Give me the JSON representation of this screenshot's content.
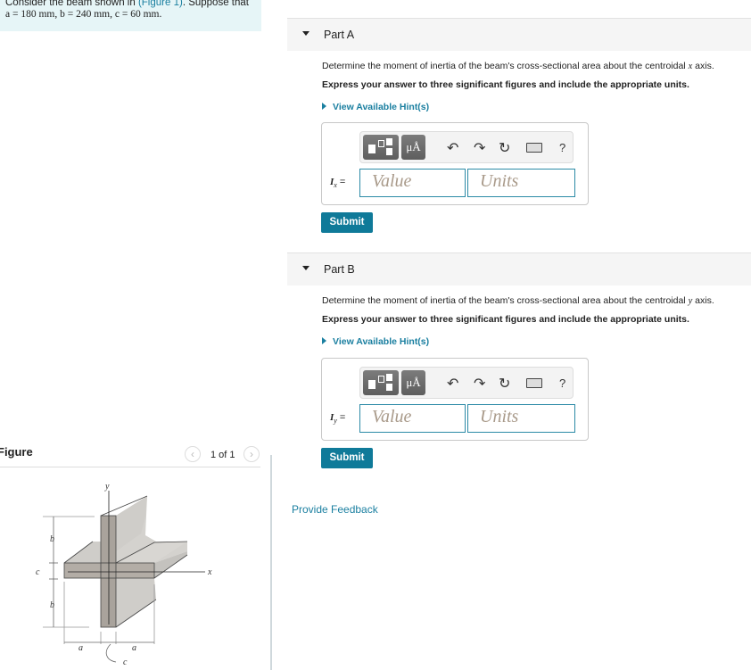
{
  "problem": {
    "line1_prefix": "Consider the beam shown in ",
    "figure_link": "(Figure 1)",
    "line1_suffix": ". Suppose that",
    "line2": "a = 180 mm, b = 240 mm, c = 60 mm."
  },
  "figure": {
    "title": "Figure",
    "pager": "1 of 1",
    "prev_icon": "chevron-left",
    "next_icon": "chevron-right",
    "labels": {
      "y": "y",
      "x": "x",
      "a": "a",
      "b": "b",
      "c": "c"
    }
  },
  "parts": [
    {
      "label": "Part A",
      "question": "Determine the moment of inertia of the beam's cross-sectional area about the centroidal x axis.",
      "question_prefix": "Determine the moment of inertia of the beam's cross-sectional area about the centroidal ",
      "axis": "x",
      "question_suffix": " axis.",
      "instruction": "Express your answer to three significant figures and include the appropriate units.",
      "hint": "View Available Hint(s)",
      "var_label": "I",
      "var_sub": "x",
      "var_eq": " =",
      "value_placeholder": "Value",
      "units_placeholder": "Units",
      "submit": "Submit"
    },
    {
      "label": "Part B",
      "question_prefix": "Determine the moment of inertia of the beam's cross-sectional area about the centroidal ",
      "axis": "y",
      "question_suffix": " axis.",
      "instruction": "Express your answer to three significant figures and include the appropriate units.",
      "hint": "View Available Hint(s)",
      "var_label": "I",
      "var_sub": "y",
      "var_eq": " =",
      "value_placeholder": "Value",
      "units_placeholder": "Units",
      "submit": "Submit"
    }
  ],
  "toolbar": {
    "units_button": "μÅ",
    "undo_icon": "undo-arrow",
    "redo_icon": "redo-arrow",
    "reset_icon": "refresh",
    "keyboard_icon": "keyboard",
    "help": "?"
  },
  "feedback": "Provide Feedback",
  "colors": {
    "accent": "#0f7a99",
    "link": "#1a7fa0",
    "problem_bg": "#e6f5f7"
  }
}
